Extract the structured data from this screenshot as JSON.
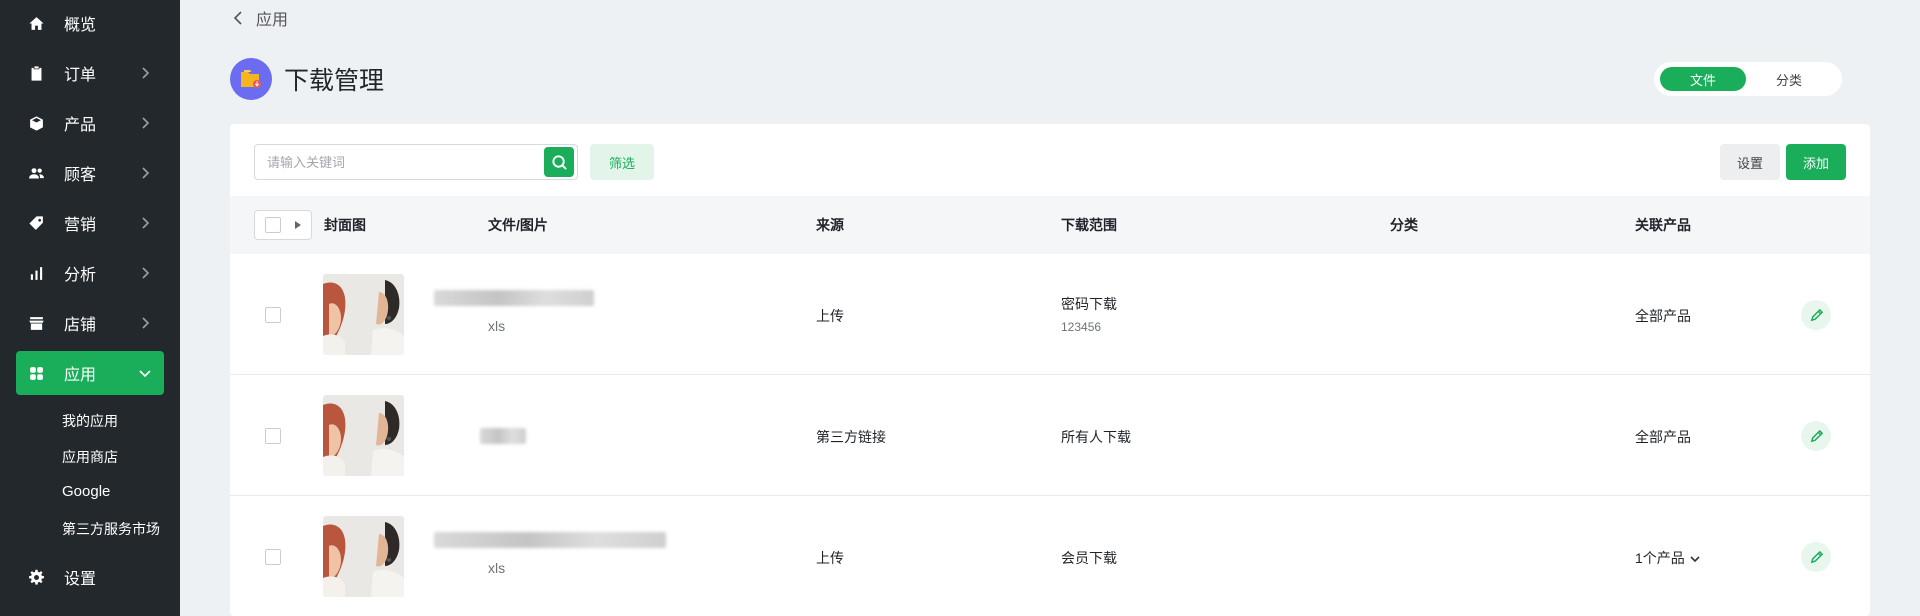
{
  "sidebar": {
    "items": [
      {
        "label": "概览",
        "icon": "home-icon"
      },
      {
        "label": "订单",
        "icon": "clipboard-icon"
      },
      {
        "label": "产品",
        "icon": "box-icon"
      },
      {
        "label": "顾客",
        "icon": "users-icon"
      },
      {
        "label": "营销",
        "icon": "tag-icon"
      },
      {
        "label": "分析",
        "icon": "bar-chart-icon"
      },
      {
        "label": "店铺",
        "icon": "store-icon"
      },
      {
        "label": "应用",
        "icon": "apps-icon"
      }
    ],
    "sub_items": [
      {
        "label": "我的应用"
      },
      {
        "label": "应用商店"
      },
      {
        "label": "Google"
      },
      {
        "label": "第三方服务市场"
      }
    ],
    "settings": {
      "label": "设置",
      "icon": "gear-icon"
    }
  },
  "breadcrumb": {
    "label": "应用"
  },
  "page": {
    "title": "下载管理"
  },
  "segment": {
    "options": [
      "文件",
      "分类"
    ],
    "selected": "文件"
  },
  "toolbar": {
    "search_placeholder": "请输入关键词",
    "filter_label": "筛选",
    "settings_label": "设置",
    "add_label": "添加"
  },
  "table": {
    "columns": [
      "封面图",
      "文件/图片",
      "来源",
      "下载范围",
      "分类",
      "关联产品"
    ],
    "rows": [
      {
        "file_ext": "xls",
        "source": "上传",
        "range": "密码下载",
        "range_detail": "123456",
        "category": "",
        "product": "全部产品"
      },
      {
        "file_ext": "",
        "source": "第三方链接",
        "range": "所有人下载",
        "range_detail": "",
        "category": "",
        "product": "全部产品"
      },
      {
        "file_ext": "xls",
        "source": "上传",
        "range": "会员下载",
        "range_detail": "",
        "category": "",
        "product": "1个产品"
      }
    ]
  },
  "colors": {
    "accent": "#1aae5a",
    "sidebar": "#23282d",
    "title_icon": "#6b6cf2"
  }
}
